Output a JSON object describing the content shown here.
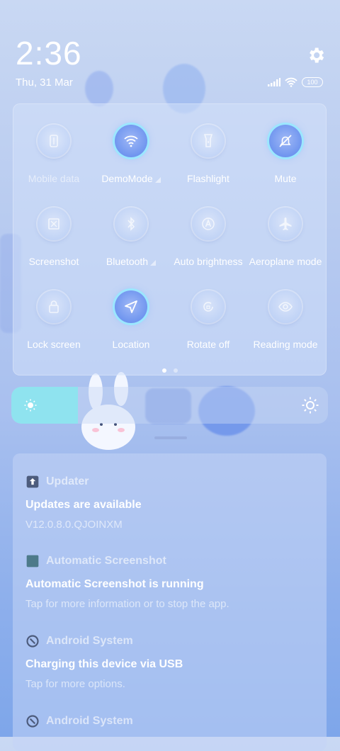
{
  "status": {
    "time": "2:36",
    "date": "Thu, 31 Mar",
    "battery": "100"
  },
  "quick_settings": {
    "tiles": [
      {
        "label": "Mobile data",
        "icon": "mobile-data-icon",
        "state": "unavailable"
      },
      {
        "label": "DemoMode",
        "icon": "wifi-icon",
        "state": "on",
        "has_menu": true
      },
      {
        "label": "Flashlight",
        "icon": "flashlight-icon",
        "state": "off"
      },
      {
        "label": "Mute",
        "icon": "mute-bell-icon",
        "state": "on"
      },
      {
        "label": "Screenshot",
        "icon": "screenshot-icon",
        "state": "off"
      },
      {
        "label": "Bluetooth",
        "icon": "bluetooth-icon",
        "state": "off",
        "has_menu": true
      },
      {
        "label": "Auto brightness",
        "icon": "auto-brightness-icon",
        "state": "off"
      },
      {
        "label": "Aeroplane mode",
        "icon": "airplane-icon",
        "state": "off"
      },
      {
        "label": "Lock screen",
        "icon": "lock-icon",
        "state": "off"
      },
      {
        "label": "Location",
        "icon": "location-icon",
        "state": "on"
      },
      {
        "label": "Rotate off",
        "icon": "rotate-lock-icon",
        "state": "off"
      },
      {
        "label": "Reading mode",
        "icon": "eye-icon",
        "state": "off"
      }
    ],
    "page_count": 2,
    "current_page": 1
  },
  "brightness": {
    "level": 0.21
  },
  "notifications": [
    {
      "app": "Updater",
      "icon": "updater-icon",
      "title": "Updates are available",
      "text": "V12.0.8.0.QJOINXM"
    },
    {
      "app": "Automatic Screenshot",
      "icon": "app-square-icon",
      "title": "Automatic Screenshot is running",
      "text": "Tap for more information or to stop the app."
    },
    {
      "app": "Android System",
      "icon": "android-system-icon",
      "title": "Charging this device via USB",
      "text": "Tap for more options."
    },
    {
      "app": "Android System",
      "icon": "android-system-icon",
      "title": "",
      "text": ""
    }
  ],
  "colors": {
    "accent": "#8fe3ef",
    "tile_on": "#6f95ef"
  }
}
